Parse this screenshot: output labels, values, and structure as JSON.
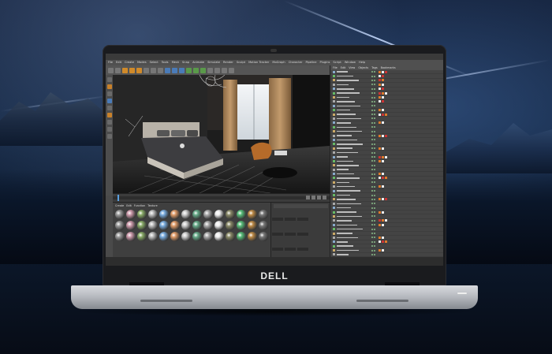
{
  "brand": {
    "logo_text": "DELL"
  },
  "app": {
    "title": "",
    "menu": [
      "File",
      "Edit",
      "Create",
      "Modes",
      "Select",
      "Tools",
      "Mesh",
      "Snap",
      "Animate",
      "Simulate",
      "Render",
      "Sculpt",
      "Motion Tracker",
      "MoGraph",
      "Character",
      "Pipeline",
      "Plugins",
      "Script",
      "Window",
      "Help"
    ],
    "object_manager_tabs": [
      "File",
      "Edit",
      "View",
      "Objects",
      "Tags",
      "Bookmarks"
    ],
    "materials_tabs": [
      "Create",
      "Edit",
      "Function",
      "Texture"
    ],
    "materials_count": 42,
    "object_rows": 68
  },
  "colors": {
    "accent_orange": "#d08a2a",
    "accent_blue": "#4a7bb8",
    "ui_dark": "#444444"
  }
}
